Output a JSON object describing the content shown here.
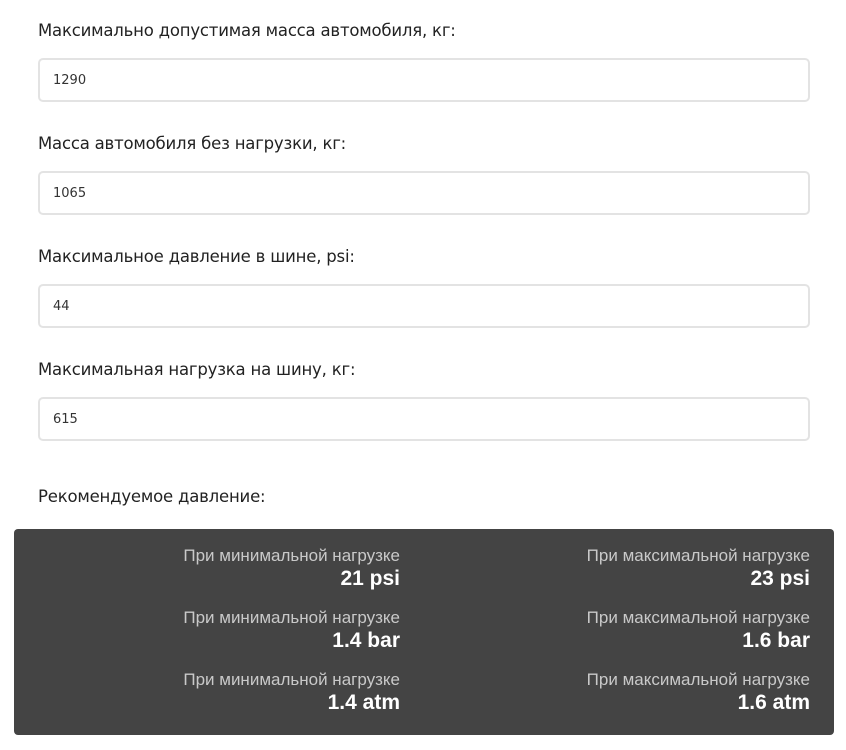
{
  "form": {
    "fields": [
      {
        "label": "Максимально допустимая масса автомобиля, кг:",
        "value": "1290"
      },
      {
        "label": "Масса автомобиля без нагрузки, кг:",
        "value": "1065"
      },
      {
        "label": "Максимальное давление в шине, psi:",
        "value": "44"
      },
      {
        "label": "Максимальная нагрузка на шину, кг:",
        "value": "615"
      }
    ]
  },
  "result": {
    "title": "Рекомендуемое давление:",
    "rows": [
      {
        "min": {
          "caption": "При минимальной нагрузке",
          "value": "21 psi"
        },
        "max": {
          "caption": "При максимальной нагрузке",
          "value": "23 psi"
        }
      },
      {
        "min": {
          "caption": "При минимальной нагрузке",
          "value": "1.4 bar"
        },
        "max": {
          "caption": "При максимальной нагрузке",
          "value": "1.6 bar"
        }
      },
      {
        "min": {
          "caption": "При минимальной нагрузке",
          "value": "1.4 atm"
        },
        "max": {
          "caption": "При максимальной нагрузке",
          "value": "1.6 atm"
        }
      }
    ]
  }
}
